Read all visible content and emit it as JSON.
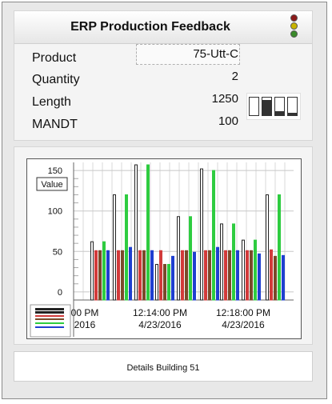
{
  "header": {
    "title": "ERP Production Feedback",
    "status_lights": [
      "#8b1a1a",
      "#c8b400",
      "#3a8a2a"
    ]
  },
  "fields": [
    {
      "label": "Product",
      "value": "75-Utt-C"
    },
    {
      "label": "Quantity",
      "value": "2"
    },
    {
      "label": "Length",
      "value": "1250"
    },
    {
      "label": "MANDT",
      "value": "100"
    }
  ],
  "gauges": [
    0,
    0.85,
    0.25,
    0.15
  ],
  "chart_data": {
    "type": "bar",
    "y_axis_label": "Value",
    "yticks": [
      "150",
      "100",
      "50",
      "0"
    ],
    "ylim": [
      -10,
      160
    ],
    "xticks": [
      {
        "time": "00 PM",
        "date": "2016"
      },
      {
        "time": "12:14:00 PM",
        "date": "4/23/2016"
      },
      {
        "time": "12:18:00 PM",
        "date": "4/23/2016"
      }
    ],
    "series_colors": [
      "#222222",
      "#d23a3a",
      "#7a4a2a",
      "#2ecc40",
      "#1f3fd0"
    ],
    "groups": [
      {
        "values": [
          62,
          51,
          51,
          62,
          51
        ]
      },
      {
        "values": [
          120,
          51,
          51,
          120,
          55
        ]
      },
      {
        "values": [
          157,
          51,
          51,
          157,
          51
        ]
      },
      {
        "values": [
          34,
          51,
          34,
          34,
          44
        ]
      },
      {
        "values": [
          93,
          51,
          51,
          93,
          49
        ]
      },
      {
        "values": [
          152,
          51,
          51,
          150,
          55
        ]
      },
      {
        "values": [
          84,
          51,
          51,
          84,
          51
        ]
      },
      {
        "values": [
          64,
          51,
          51,
          64,
          47
        ]
      },
      {
        "values": [
          120,
          52,
          44,
          120,
          45
        ]
      }
    ]
  },
  "footer": {
    "text": "Details Building 51"
  }
}
